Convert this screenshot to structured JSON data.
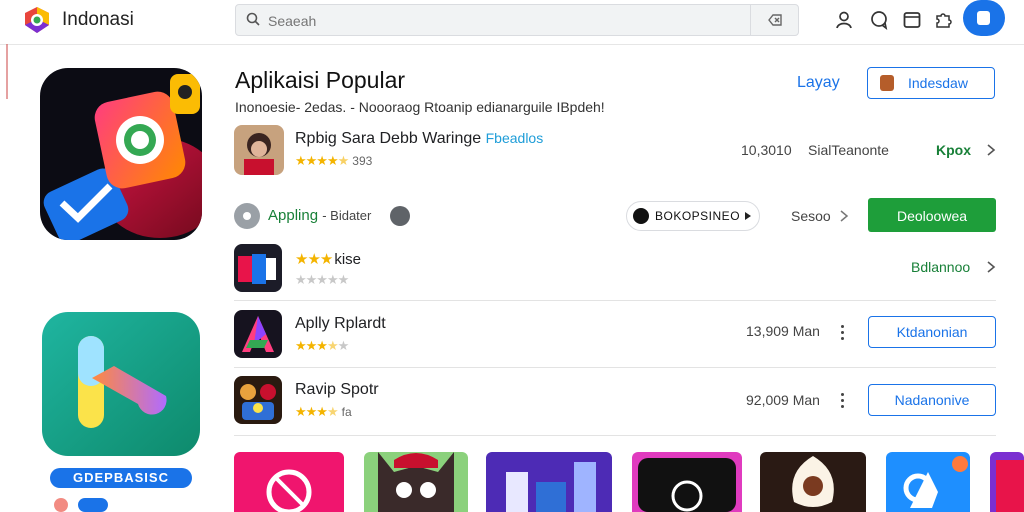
{
  "header": {
    "brand_name": "Indonasi",
    "search_placeholder": "Seaeah"
  },
  "section": {
    "title": "Aplikaisi Popular",
    "subtitle": "Inonoesie- 2edas. - Noooraog Rtoanip edianarguile IBpdeh!",
    "see_all_label": "Layay",
    "top_button_label": "Indesdaw"
  },
  "apply_strip": {
    "label": "Appling",
    "sub_label": "- Bidater",
    "pill_label": "BOKOPSINEO",
    "semua_label": "Sesoo",
    "green_button_label": "Deoloowea"
  },
  "apps": [
    {
      "name": "Rpbig Sara Debb Waringe",
      "tag": "Fbeadlos",
      "rating": 4.5,
      "rating_text": "393",
      "meta": "10,3010",
      "meta2": "SialTeanonte",
      "action_label": "Kpox"
    },
    {
      "name": "kise",
      "rating": 3,
      "rating_text": "",
      "action_label": "Bdlannoo"
    },
    {
      "name": "Aplly Rplardt",
      "rating": 3.5,
      "rating_text": "",
      "meta": "13,909 Man",
      "action_label": "Ktdanonian"
    },
    {
      "name": "Ravip Spotr",
      "rating": 4,
      "rating_text": "fa",
      "meta": "92,009 Man",
      "action_label": "Nadanonive"
    }
  ],
  "left_tag_label": "GDEPBASISC",
  "colors": {
    "accent_blue": "#1a73e8",
    "green": "#1e9e3a",
    "star": "#f4b400"
  },
  "icons": {
    "top_right": [
      "person-icon",
      "chat-icon",
      "window-icon",
      "puzzle-icon",
      "account-icon"
    ]
  }
}
